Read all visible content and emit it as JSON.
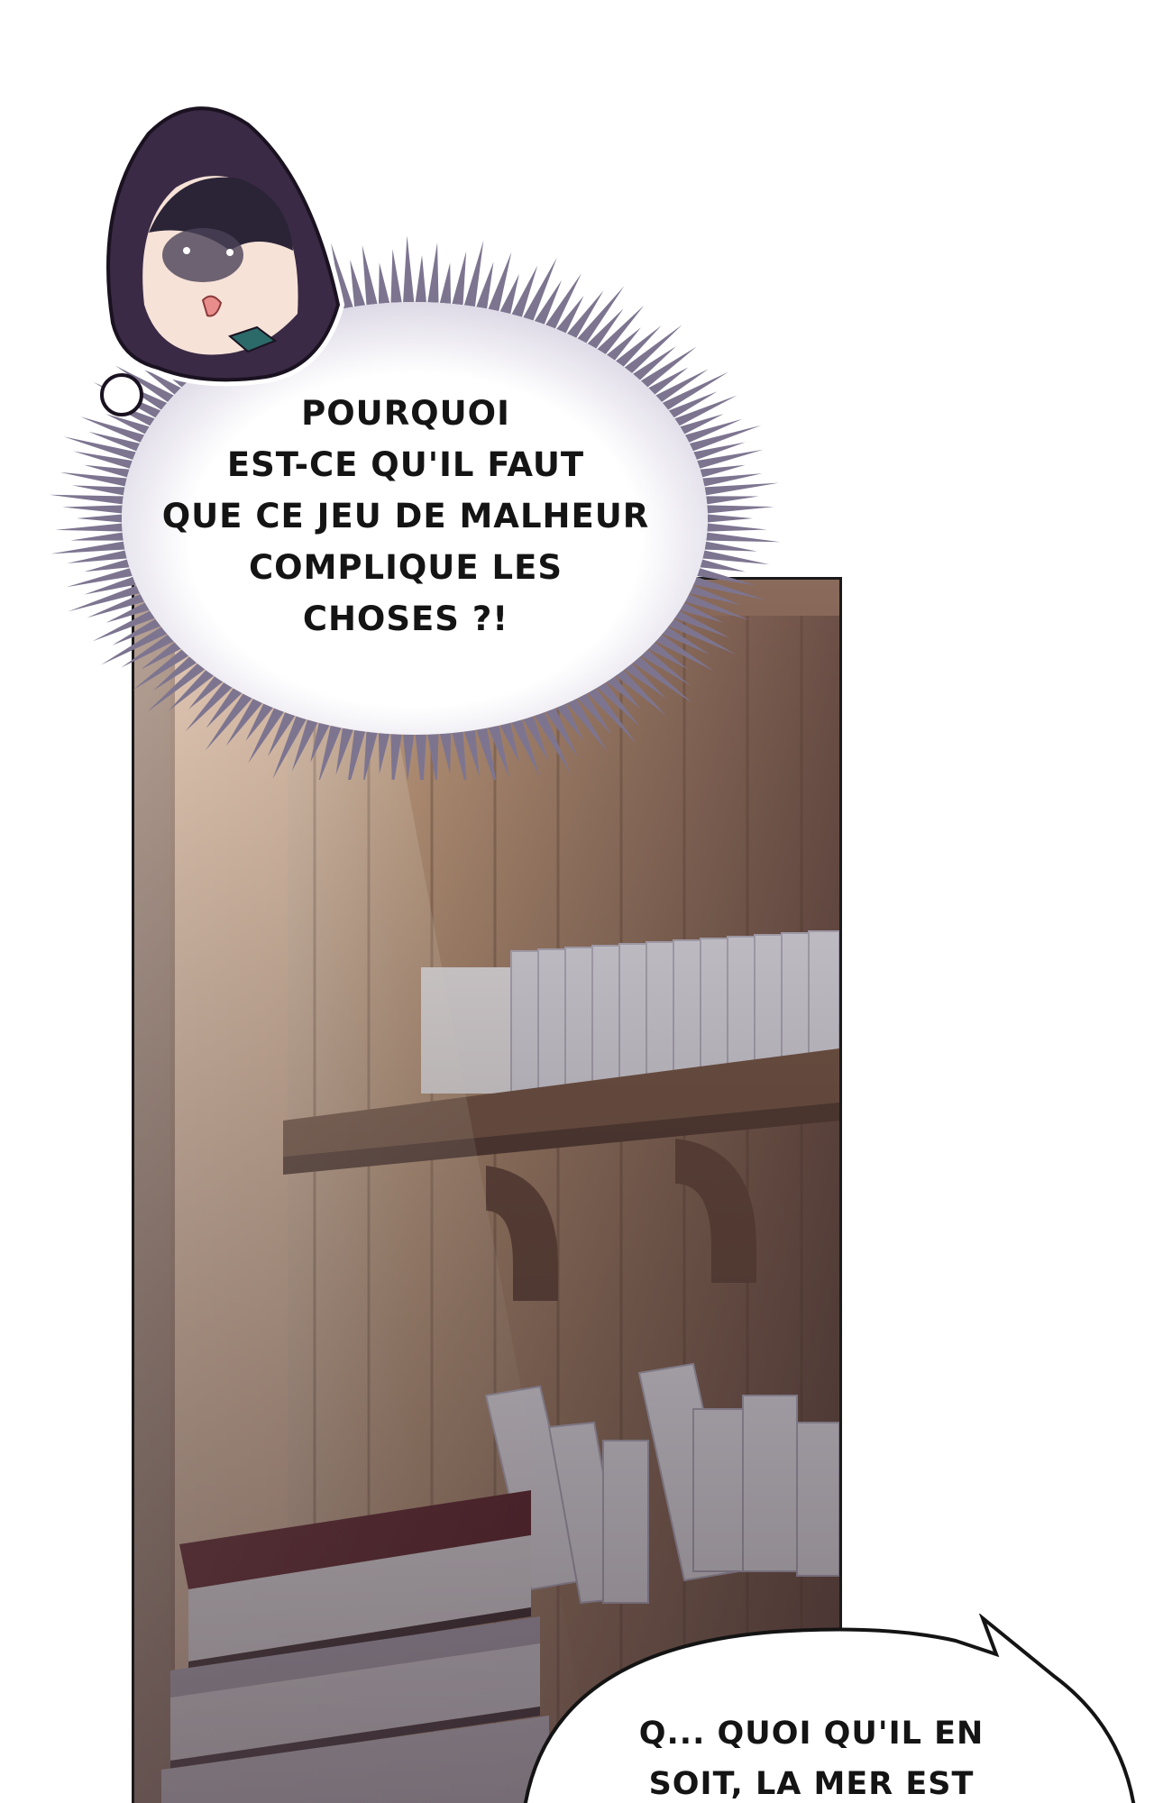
{
  "speech_bubbles": {
    "thought": {
      "lines": [
        "POURQUOI",
        "EST-CE QU'IL FAUT",
        "QUE CE JEU DE MALHEUR",
        "COMPLIQUE LES",
        "CHOSES ?!"
      ]
    },
    "speech": {
      "lines": [
        "Q... QUOI QU'IL EN",
        "SOIT, LA MER EST"
      ]
    }
  },
  "colors": {
    "panel_border": "#1a1a1a",
    "burst_spikes": "#7d7590",
    "hood": "#3a2a45"
  }
}
